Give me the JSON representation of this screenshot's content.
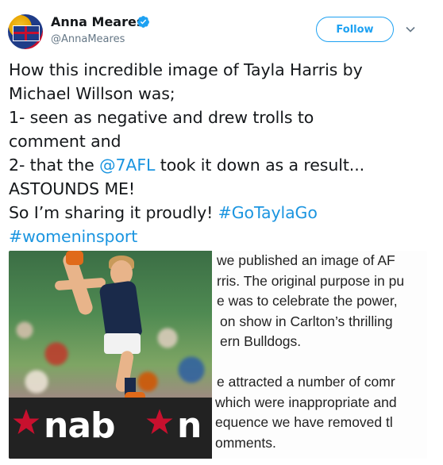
{
  "author": {
    "name": "Anna Meares",
    "handle": "@AnnaMeares",
    "verified": true
  },
  "follow_label": "Follow",
  "tweet_lines": [
    [
      {
        "t": "How this incredible image of Tayla Harris by"
      }
    ],
    [
      {
        "t": "Michael Willson was;"
      }
    ],
    [
      {
        "t": "1- seen as negative and drew trolls to"
      }
    ],
    [
      {
        "t": "comment and"
      }
    ],
    [
      {
        "t": "2- that the "
      },
      {
        "t": "@7AFL",
        "link": true
      },
      {
        "t": " took it down as a result..."
      }
    ],
    [
      {
        "t": "ASTOUNDS ME!"
      }
    ],
    [
      {
        "t": "So I’m sharing it proudly! "
      },
      {
        "t": "#GoTaylaGo",
        "link": true
      }
    ],
    [
      {
        "t": "#womeninsport",
        "link": true
      }
    ]
  ],
  "media": {
    "board_text": "nab",
    "board_text_partial": "n",
    "statement_lines": [
      "we published an image of AF",
      "rris. The original purpose in pu",
      "e was to celebrate the power,",
      "on show in Carlton’s thrilling",
      "ern Bulldogs.",
      "",
      "e attracted a number of comr",
      "which were inappropriate and",
      "equence we have removed tl",
      "omments."
    ]
  },
  "colors": {
    "link": "#1b95e0",
    "follow": "#1da1f2",
    "text": "#14171a",
    "handle": "#657786"
  },
  "icons": [
    "verified-badge-icon",
    "chevron-down-icon"
  ]
}
